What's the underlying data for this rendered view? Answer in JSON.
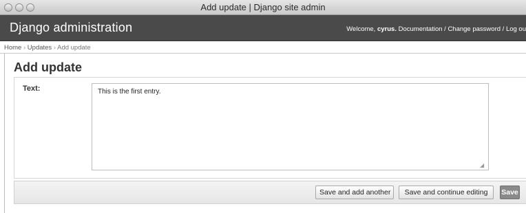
{
  "window": {
    "title": "Add update | Django site admin"
  },
  "header": {
    "branding": "Django administration",
    "welcome_prefix": "Welcome, ",
    "username": "cyrus.",
    "documentation": "Documentation",
    "separator1": " / ",
    "change_password": "Change password",
    "separator2": " / ",
    "logout": "Log ou"
  },
  "breadcrumbs": {
    "home": "Home",
    "sep": " › ",
    "updates": "Updates",
    "current": "Add update"
  },
  "page": {
    "title": "Add update"
  },
  "form": {
    "text_label": "Text:",
    "text_value": "This is the first entry."
  },
  "submit_row": {
    "save_add_another": "Save and add another",
    "save_continue": "Save and continue editing",
    "save": "Save"
  }
}
